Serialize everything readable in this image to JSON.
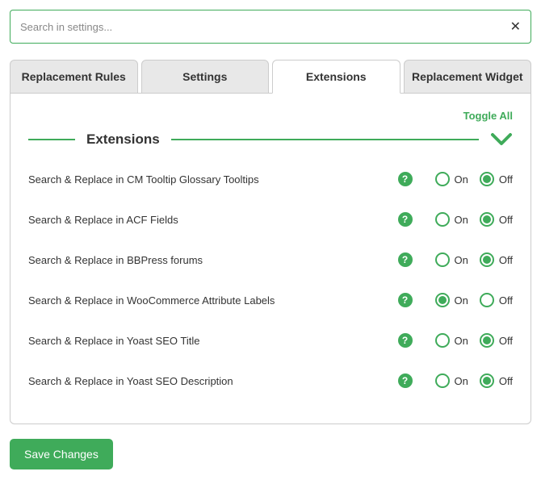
{
  "search": {
    "placeholder": "Search in settings..."
  },
  "tabs": [
    {
      "label": "Replacement Rules"
    },
    {
      "label": "Settings"
    },
    {
      "label": "Extensions"
    },
    {
      "label": "Replacement Widget"
    }
  ],
  "activeTab": 2,
  "toggleAll": "Toggle All",
  "section": {
    "title": "Extensions"
  },
  "labels": {
    "on": "On",
    "off": "Off"
  },
  "rows": [
    {
      "label": "Search & Replace in CM Tooltip Glossary Tooltips",
      "value": "off"
    },
    {
      "label": "Search & Replace in ACF Fields",
      "value": "off"
    },
    {
      "label": "Search & Replace in BBPress forums",
      "value": "off"
    },
    {
      "label": "Search & Replace in WooCommerce Attribute Labels",
      "value": "on"
    },
    {
      "label": "Search & Replace in Yoast SEO Title",
      "value": "off"
    },
    {
      "label": "Search & Replace in Yoast SEO Description",
      "value": "off"
    }
  ],
  "saveLabel": "Save Changes"
}
